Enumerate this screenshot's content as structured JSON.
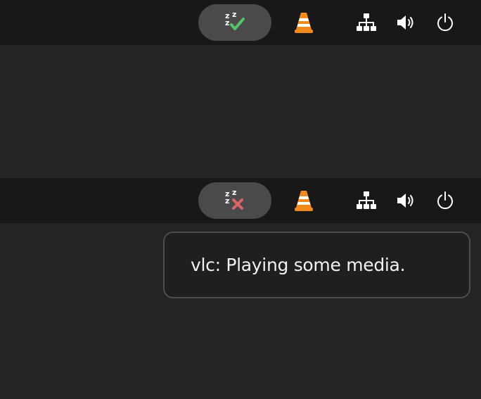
{
  "panels": [
    {
      "caffeine_state": "enabled",
      "icons": [
        "caffeine-enabled-icon",
        "vlc-icon",
        "network-icon",
        "volume-icon",
        "power-icon"
      ]
    },
    {
      "caffeine_state": "disabled",
      "icons": [
        "caffeine-disabled-icon",
        "vlc-icon",
        "network-icon",
        "volume-icon",
        "power-icon"
      ]
    }
  ],
  "notification": {
    "text": "vlc: Playing some media."
  },
  "colors": {
    "panel_bg": "#181818",
    "desktop_bg": "#242424",
    "pill_bg": "#4a4a4a",
    "check_green": "#57c46a",
    "cross_red": "#d8656a",
    "vlc_orange": "#f08a1c"
  }
}
